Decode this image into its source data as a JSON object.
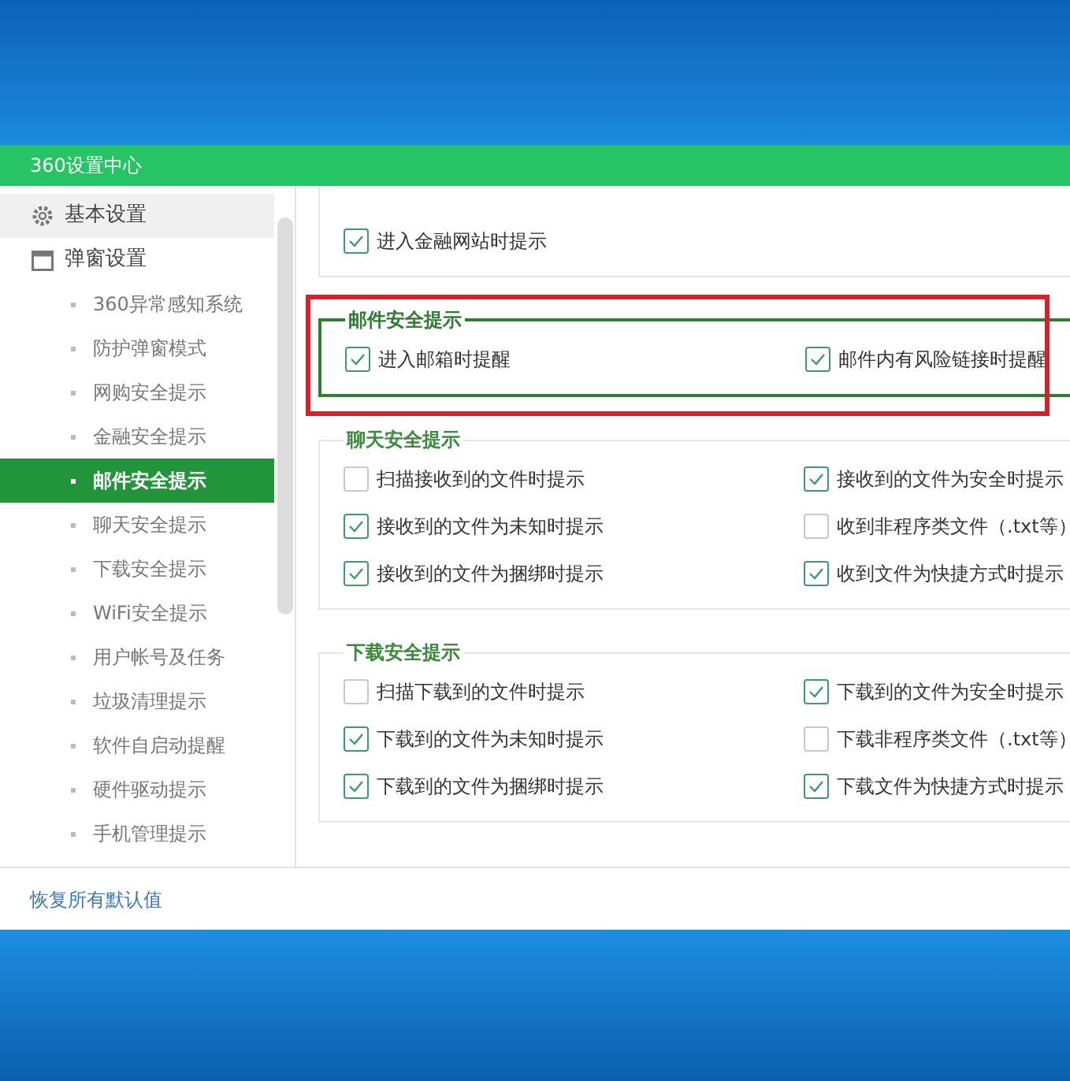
{
  "window": {
    "title": "360设置中心"
  },
  "sidebar": {
    "items": [
      {
        "label": "基本设置",
        "kind": "group",
        "selected": false
      },
      {
        "label": "弹窗设置",
        "kind": "group",
        "selected": false
      },
      {
        "label": "360异常感知系统",
        "kind": "sub",
        "selected": false
      },
      {
        "label": "防护弹窗模式",
        "kind": "sub",
        "selected": false
      },
      {
        "label": "网购安全提示",
        "kind": "sub",
        "selected": false
      },
      {
        "label": "金融安全提示",
        "kind": "sub",
        "selected": false
      },
      {
        "label": "邮件安全提示",
        "kind": "sub",
        "selected": true
      },
      {
        "label": "聊天安全提示",
        "kind": "sub",
        "selected": false
      },
      {
        "label": "下载安全提示",
        "kind": "sub",
        "selected": false
      },
      {
        "label": "WiFi安全提示",
        "kind": "sub",
        "selected": false
      },
      {
        "label": "用户帐号及任务",
        "kind": "sub",
        "selected": false
      },
      {
        "label": "垃圾清理提示",
        "kind": "sub",
        "selected": false
      },
      {
        "label": "软件自启动提醒",
        "kind": "sub",
        "selected": false
      },
      {
        "label": "硬件驱动提示",
        "kind": "sub",
        "selected": false
      },
      {
        "label": "手机管理提示",
        "kind": "sub",
        "selected": false
      }
    ]
  },
  "sections": [
    {
      "highlighted": false,
      "options": [
        {
          "label": "进入金融网站时提示",
          "checked": true
        }
      ]
    },
    {
      "title": "邮件安全提示",
      "highlighted": true,
      "options": [
        {
          "label": "进入邮箱时提醒",
          "checked": true
        },
        {
          "label": "邮件内有风险链接时提醒",
          "checked": true
        }
      ]
    },
    {
      "title": "聊天安全提示",
      "highlighted": false,
      "options": [
        {
          "label": "扫描接收到的文件时提示",
          "checked": false
        },
        {
          "label": "接收到的文件为安全时提示",
          "checked": true
        },
        {
          "label": "接收到的文件为未知时提示",
          "checked": true
        },
        {
          "label": "收到非程序类文件（.txt等）",
          "checked": false
        },
        {
          "label": "接收到的文件为捆绑时提示",
          "checked": true
        },
        {
          "label": "收到文件为快捷方式时提示",
          "checked": true
        }
      ]
    },
    {
      "title": "下载安全提示",
      "highlighted": false,
      "options": [
        {
          "label": "扫描下载到的文件时提示",
          "checked": false
        },
        {
          "label": "下载到的文件为安全时提示",
          "checked": true
        },
        {
          "label": "下载到的文件为未知时提示",
          "checked": true
        },
        {
          "label": "下载非程序类文件（.txt等）",
          "checked": false
        },
        {
          "label": "下载到的文件为捆绑时提示",
          "checked": true
        },
        {
          "label": "下载文件为快捷方式时提示",
          "checked": true
        }
      ]
    }
  ],
  "footer": {
    "link": "恢复所有默认值"
  }
}
